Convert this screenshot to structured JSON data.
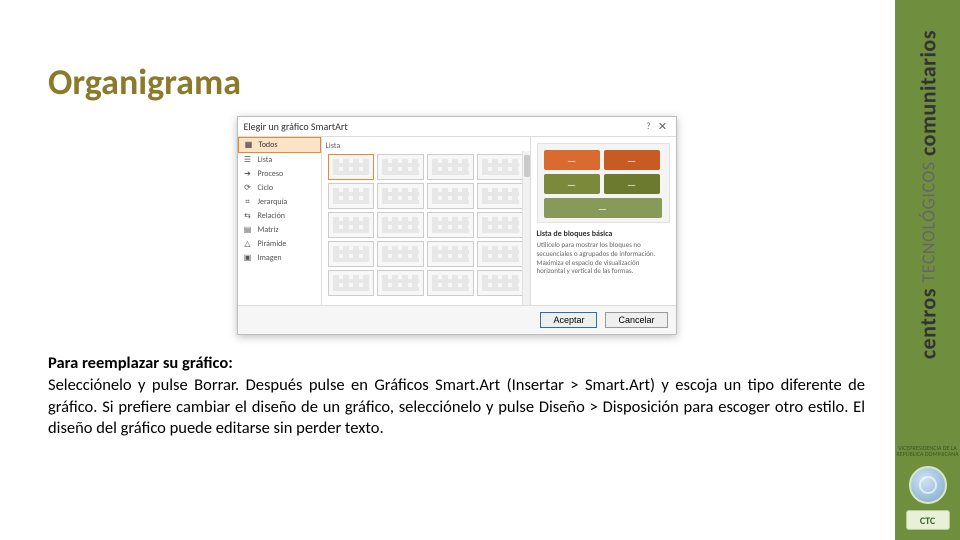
{
  "slide": {
    "title": "Organigrama",
    "instructions_heading": "Para reemplazar su gráfico:",
    "instructions_body": "Selecciónelo y pulse Borrar. Después pulse en Gráficos Smart.Art (Insertar > Smart.Art) y escoja un tipo diferente de gráfico. Si prefiere cambiar el diseño de un gráfico, selecciónelo y pulse Diseño > Disposición para escoger otro estilo. El diseño del gráfico puede editarse sin perder texto."
  },
  "dialog": {
    "title": "Elegir un gráfico SmartArt",
    "help_glyph": "?",
    "close_glyph": "✕",
    "gallery_heading": "Lista",
    "categories": [
      "Todos",
      "Lista",
      "Proceso",
      "Ciclo",
      "Jerarquía",
      "Relación",
      "Matriz",
      "Pirámide",
      "Imagen"
    ],
    "preview_title": "Lista de bloques básica",
    "preview_desc": "Utilícelo para mostrar los bloques no secuenciales o agrupados de información. Maximiza el espacio de visualización horizontal y vertical de las formas.",
    "block_glyph": "—",
    "accept_label": "Aceptar",
    "cancel_label": "Cancelar"
  },
  "brand": {
    "line1_bold": "centros",
    "line1_thin": "TECNOLÓGICOS",
    "line2_bold": "comunitarios",
    "subtitle": "VICEPRESIDENCIA DE LA REPÚBLICA DOMINICANA",
    "ctc_label": "CTC"
  }
}
